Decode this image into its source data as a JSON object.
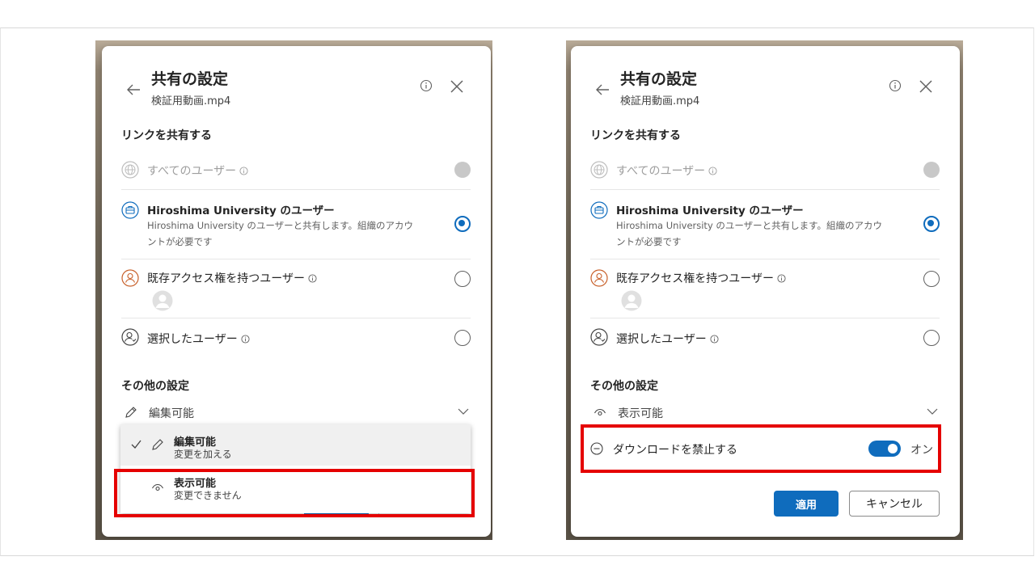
{
  "left_dialog": {
    "title": "共有の設定",
    "filename": "検証用動画.mp4",
    "link_section": "リンクを共有する",
    "options": [
      {
        "label": "すべてのユーザー",
        "state": "disabled"
      },
      {
        "label": "Hiroshima University のユーザー",
        "desc": "Hiroshima University のユーザーと共有します。組織のアカウントが必要です",
        "state": "selected"
      },
      {
        "label": "既存アクセス権を持つユーザー",
        "state": "unselected"
      },
      {
        "label": "選択したユーザー",
        "state": "unselected"
      }
    ],
    "other_section": "その他の設定",
    "permission_value": "編集可能",
    "menu": [
      {
        "title": "編集可能",
        "desc": "変更を加える",
        "checked": true
      },
      {
        "title": "表示可能",
        "desc": "変更できません",
        "checked": false
      }
    ]
  },
  "right_dialog": {
    "title": "共有の設定",
    "filename": "検証用動画.mp4",
    "link_section": "リンクを共有する",
    "options": [
      {
        "label": "すべてのユーザー",
        "state": "disabled"
      },
      {
        "label": "Hiroshima University のユーザー",
        "desc": "Hiroshima University のユーザーと共有します。組織のアカウントが必要です",
        "state": "selected"
      },
      {
        "label": "既存アクセス権を持つユーザー",
        "state": "unselected"
      },
      {
        "label": "選択したユーザー",
        "state": "unselected"
      }
    ],
    "other_section": "その他の設定",
    "permission_value": "表示可能",
    "block_download_label": "ダウンロードを禁止する",
    "toggle_state": "オン",
    "apply_label": "適用",
    "cancel_label": "キャンセル"
  },
  "colors": {
    "accent": "#0f6cbd",
    "highlight": "#e50000"
  },
  "icons": [
    "back-arrow-icon",
    "info-icon",
    "close-icon",
    "globe-icon",
    "briefcase-icon",
    "person-icon",
    "person-add-icon",
    "pencil-icon",
    "eye-icon",
    "check-icon",
    "chevron-down-icon",
    "block-icon"
  ]
}
